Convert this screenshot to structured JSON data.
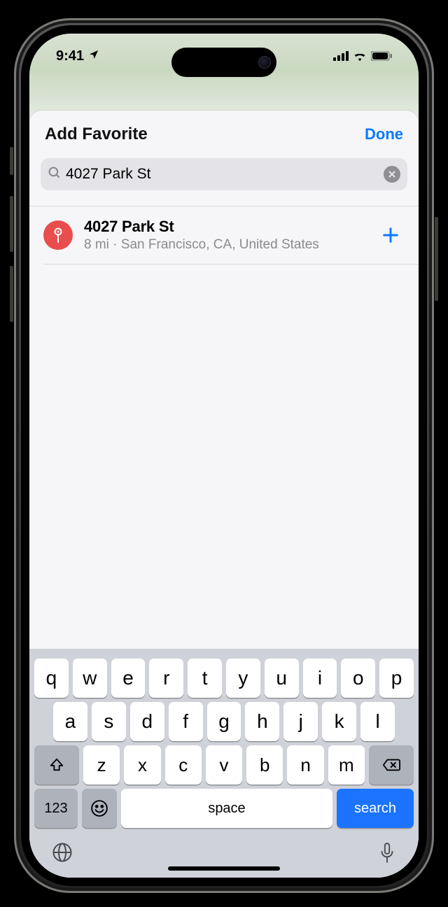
{
  "status": {
    "time": "9:41",
    "location_icon": "location-arrow",
    "signal": 4,
    "wifi": 3,
    "battery": 100
  },
  "sheet": {
    "title": "Add Favorite",
    "done_label": "Done"
  },
  "search": {
    "value": "4027 Park St",
    "placeholder": "Search"
  },
  "results": [
    {
      "title": "4027 Park St",
      "distance": "8 mi",
      "separator": " · ",
      "subtitle": "San Francisco, CA, United States"
    }
  ],
  "keyboard": {
    "row1": [
      "q",
      "w",
      "e",
      "r",
      "t",
      "y",
      "u",
      "i",
      "o",
      "p"
    ],
    "row2": [
      "a",
      "s",
      "d",
      "f",
      "g",
      "h",
      "j",
      "k",
      "l"
    ],
    "row3": [
      "z",
      "x",
      "c",
      "v",
      "b",
      "n",
      "m"
    ],
    "numbers_label": "123",
    "space_label": "space",
    "action_label": "search"
  }
}
